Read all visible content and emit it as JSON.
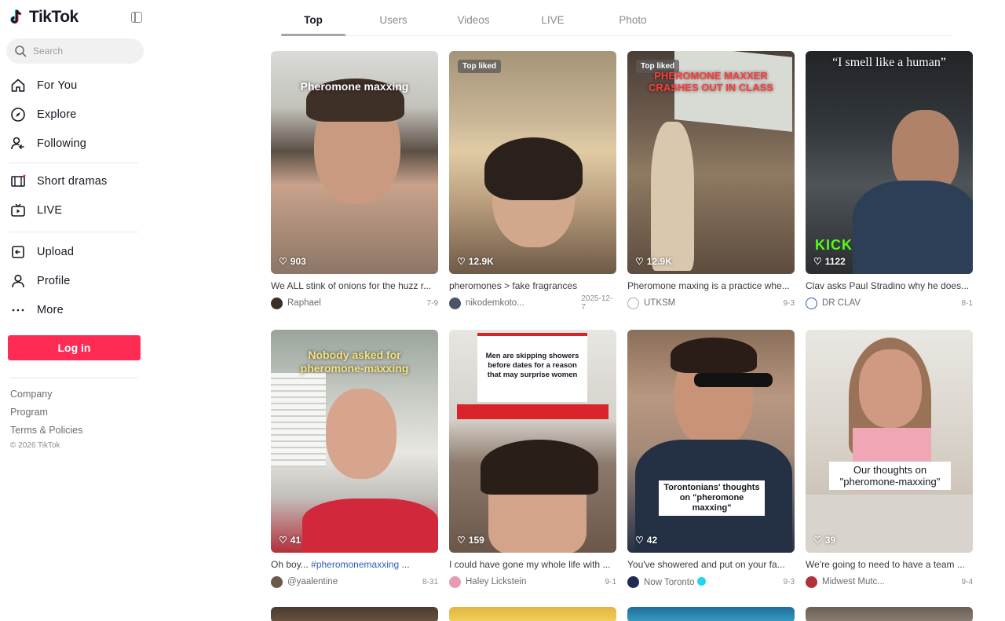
{
  "brand": {
    "name": "TikTok"
  },
  "search": {
    "placeholder": "Search"
  },
  "nav": [
    {
      "label": "For You",
      "icon": "home-icon"
    },
    {
      "label": "Explore",
      "icon": "compass-icon"
    },
    {
      "label": "Following",
      "icon": "following-icon"
    },
    {
      "label": "Short dramas",
      "icon": "short-dramas-icon"
    },
    {
      "label": "LIVE",
      "icon": "live-tv-icon"
    },
    {
      "label": "Upload",
      "icon": "upload-icon"
    },
    {
      "label": "Profile",
      "icon": "profile-icon"
    },
    {
      "label": "More",
      "icon": "more-dots-icon"
    }
  ],
  "login_label": "Log in",
  "footer": {
    "links": [
      "Company",
      "Program",
      "Terms & Policies"
    ],
    "copyright": "© 2026 TikTok"
  },
  "tabs": [
    "Top",
    "Users",
    "Videos",
    "LIVE",
    "Photo"
  ],
  "active_tab": "Top",
  "colors": {
    "accent": "#fe2c55",
    "text": "#161823",
    "muted": "#8a8b91"
  },
  "videos": [
    {
      "likes": "903",
      "title": "We ALL stink of onions for the huzz r...",
      "author": "Raphael",
      "date": "7-9",
      "overlay": "Pheromone maxxing"
    },
    {
      "likes": "12.9K",
      "title": "pheromones > fake fragrances",
      "author": "nikodemkoto...",
      "date": "2025-12-7",
      "badge": "Top liked"
    },
    {
      "likes": "12.9K",
      "title": "Pheromone maxing is a practice whe...",
      "author": "UTKSM",
      "date": "9-3",
      "badge": "Top liked",
      "overlay": "PHEROMONE MAXXER CRASHES OUT IN CLASS"
    },
    {
      "likes": "1122",
      "title": "Clav asks Paul Stradino why he does...",
      "author": "DR CLAV",
      "date": "8-1",
      "overlay": "“I smell like a human”"
    },
    {
      "likes": "41",
      "title_pre": "Oh boy... ",
      "title_tag": "#pheromonemaxxing",
      "title_post": " ...",
      "author": "@yaalentine",
      "date": "8-31",
      "overlay": "Nobody asked for pheromone-maxxing"
    },
    {
      "likes": "159",
      "title": "I could have gone my whole life with ...",
      "author": "Haley Lickstein",
      "date": "9-1",
      "overlay": "Men are skipping showers before dates for a reason that may surprise women"
    },
    {
      "likes": "42",
      "title": "You've showered and put on your fa...",
      "author": "Now Toronto",
      "date": "9-3",
      "overlay": "Torontonians' thoughts on \"pheromone maxxing\""
    },
    {
      "likes": "39",
      "title": "We're going to need to have a team ...",
      "author": "Midwest Mutc...",
      "date": "9-4",
      "overlay": "Our thoughts on \"pheromone-maxxing\""
    }
  ]
}
